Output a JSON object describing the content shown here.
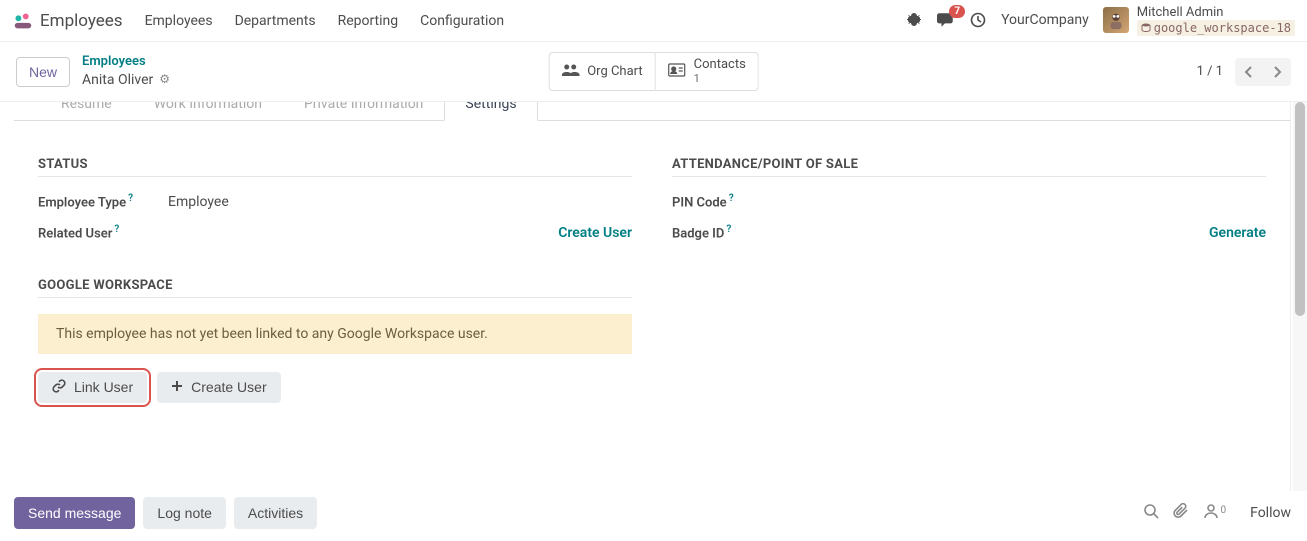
{
  "app": {
    "title": "Employees",
    "nav": [
      "Employees",
      "Departments",
      "Reporting",
      "Configuration"
    ]
  },
  "header_right": {
    "message_count": "7",
    "company": "YourCompany",
    "user_name": "Mitchell Admin",
    "db_label": "google_workspace-18"
  },
  "control": {
    "new_label": "New",
    "breadcrumb_parent": "Employees",
    "breadcrumb_current": "Anita Oliver",
    "orgchart_label": "Org Chart",
    "contacts_label": "Contacts",
    "contacts_count": "1",
    "pager": "1 / 1"
  },
  "tabs": [
    "Resume",
    "Work Information",
    "Private Information",
    "Settings"
  ],
  "status_section": {
    "title": "STATUS",
    "employee_type_label": "Employee Type",
    "employee_type_value": "Employee",
    "related_user_label": "Related User",
    "create_user_action": "Create User"
  },
  "attendance_section": {
    "title": "ATTENDANCE/POINT OF SALE",
    "pin_label": "PIN Code",
    "badge_label": "Badge ID",
    "generate_action": "Generate"
  },
  "gw_section": {
    "title": "GOOGLE WORKSPACE",
    "alert_text": "This employee has not yet been linked to any Google Workspace user.",
    "link_user_label": "Link User",
    "create_user_label": "Create User"
  },
  "chatter": {
    "send_message": "Send message",
    "log_note": "Log note",
    "activities": "Activities",
    "follower_count": "0",
    "follow": "Follow"
  }
}
